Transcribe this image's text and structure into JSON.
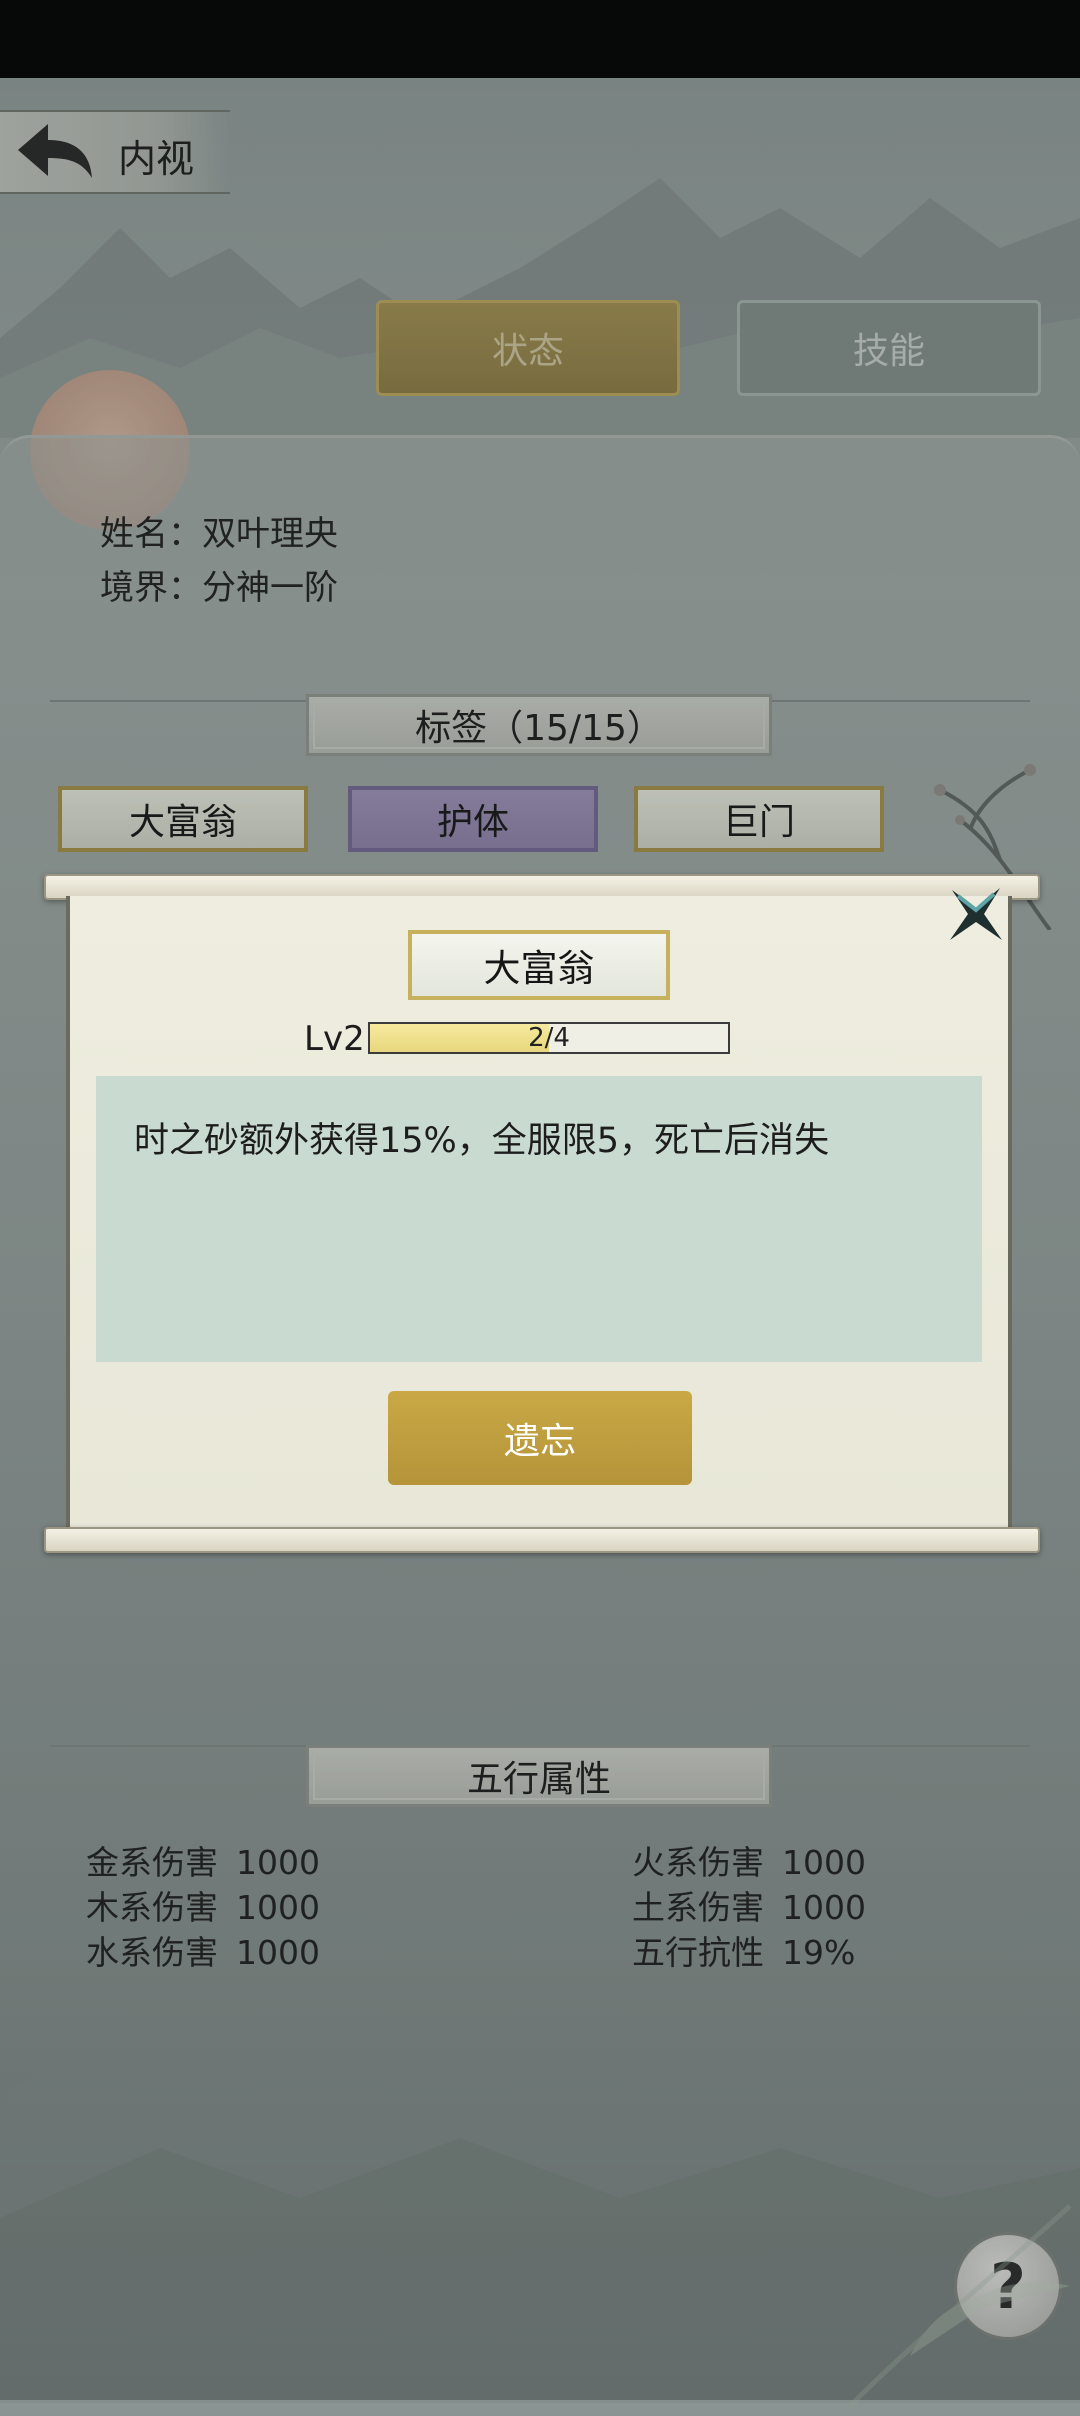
{
  "header": {
    "title": "内视"
  },
  "tabs": [
    {
      "label": "状态",
      "active": true
    },
    {
      "label": "技能",
      "active": false
    }
  ],
  "profile": {
    "name": "姓名：双叶理央",
    "realm": "境界：分神一阶"
  },
  "tags_section": {
    "title": "标签（15/15）",
    "tags": [
      {
        "label": "大富翁"
      },
      {
        "label": "护体"
      },
      {
        "label": "巨门"
      }
    ]
  },
  "modal": {
    "tag_label": "大富翁",
    "level": "Lv2",
    "progress_text": "2/4",
    "progress_fraction": 0.5,
    "description": "时之砂额外获得15%，全服限5，死亡后消失",
    "forget_button": "遗忘"
  },
  "elements_section": {
    "title": "五行属性",
    "left": [
      {
        "label": "金系伤害",
        "value": "1000"
      },
      {
        "label": "木系伤害",
        "value": "1000"
      },
      {
        "label": "水系伤害",
        "value": "1000"
      }
    ],
    "right": [
      {
        "label": "火系伤害",
        "value": "1000"
      },
      {
        "label": "土系伤害",
        "value": "1000"
      },
      {
        "label": "五行抗性",
        "value": "19%"
      }
    ]
  },
  "help": {
    "label": "?"
  },
  "colors": {
    "gold": "#b5943a",
    "panel": "#e8e7d8",
    "desc_bg": "#c9dbd0",
    "purple_tag": "#8a7ea4"
  }
}
